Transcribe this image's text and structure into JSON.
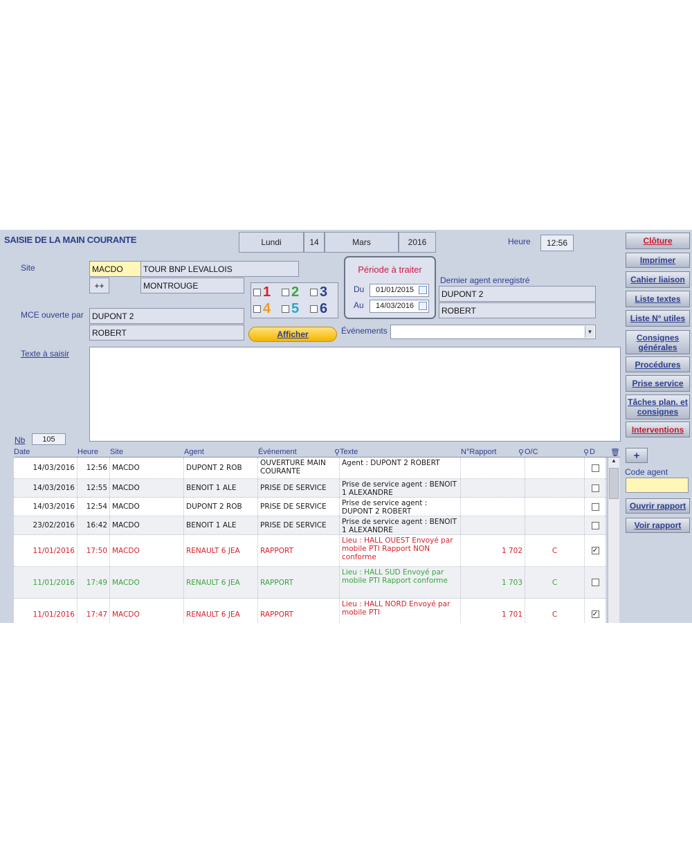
{
  "title": "SAISIE DE LA MAIN COURANTE",
  "date": {
    "day_name": "Lundi",
    "day": "14",
    "month": "Mars",
    "year": "2016"
  },
  "time": {
    "label": "Heure",
    "value": "12:56"
  },
  "site": {
    "label": "Site",
    "code": "MACDO",
    "name": "TOUR BNP LEVALLOIS",
    "extra_button": "++",
    "city": "MONTROUGE"
  },
  "mce": {
    "label": "MCE ouverte par",
    "name1": "DUPONT 2",
    "name2": "ROBERT"
  },
  "checkboxes": [
    {
      "num": "1",
      "color": "#d61f2a"
    },
    {
      "num": "2",
      "color": "#3aa53c"
    },
    {
      "num": "3",
      "color": "#2d3f8c"
    },
    {
      "num": "4",
      "color": "#f29a1e"
    },
    {
      "num": "5",
      "color": "#2aa7c8"
    },
    {
      "num": "6",
      "color": "#2d3f8c"
    }
  ],
  "periode": {
    "title": "Période à traiter",
    "du_label": "Du",
    "du_value": "01/01/2015",
    "au_label": "Au",
    "au_value": "14/03/2016"
  },
  "dernier_agent": {
    "label": "Dernier agent enregistré",
    "name1": "DUPONT 2",
    "name2": "ROBERT"
  },
  "afficher_label": "Afficher",
  "evenements_label": "Événements",
  "texte_label": "Texte à saisir",
  "nb": {
    "label": "Nb",
    "value": "105"
  },
  "side_buttons": [
    {
      "label": "Clôture",
      "red": true
    },
    {
      "label": "Imprimer",
      "red": false
    },
    {
      "label": "Cahier liaison",
      "red": false
    },
    {
      "label": "Liste textes",
      "red": false
    },
    {
      "label": "Liste N° utiles",
      "red": false
    },
    {
      "label": "Consignes générales",
      "red": false
    },
    {
      "label": "Procédures",
      "red": false
    },
    {
      "label": "Prise service",
      "red": false
    },
    {
      "label": "Tâches plan. et consignes",
      "red": false
    },
    {
      "label": "Interventions",
      "red": true
    }
  ],
  "plus_label": "+",
  "code_agent_label": "Code agent",
  "ouvrir_rapport": "Ouvrir rapport",
  "voir_rapport": "Voir rapport",
  "columns": {
    "date": "Date",
    "heure": "Heure",
    "site": "Site",
    "agent": "Agent",
    "evenement": "Événement",
    "texte": "Texte",
    "rapport": "N°Rapport",
    "oc": "O/C",
    "d": "D"
  },
  "rows": [
    {
      "date": "14/03/2016",
      "heure": "12:56",
      "site": "MACDO",
      "agent": "DUPONT 2 ROB",
      "evenement": "OUVERTURE MAIN COURANTE",
      "texte": "Agent : DUPONT 2 ROBERT",
      "rapport": "",
      "oc": "",
      "checked": false,
      "color": "normal"
    },
    {
      "date": "14/03/2016",
      "heure": "12:55",
      "site": "MACDO",
      "agent": "BENOIT 1 ALE",
      "evenement": "PRISE DE SERVICE",
      "texte": "Prise de service agent : BENOIT 1 ALEXANDRE",
      "rapport": "",
      "oc": "",
      "checked": false,
      "color": "normal"
    },
    {
      "date": "14/03/2016",
      "heure": "12:54",
      "site": "MACDO",
      "agent": "DUPONT 2 ROB",
      "evenement": "PRISE DE SERVICE",
      "texte": "Prise de service agent : DUPONT 2 ROBERT",
      "rapport": "",
      "oc": "",
      "checked": false,
      "color": "normal"
    },
    {
      "date": "23/02/2016",
      "heure": "16:42",
      "site": "MACDO",
      "agent": "BENOIT 1 ALE",
      "evenement": "PRISE DE SERVICE",
      "texte": "Prise de service agent : BENOIT 1 ALEXANDRE",
      "rapport": "",
      "oc": "",
      "checked": false,
      "color": "normal"
    },
    {
      "date": "11/01/2016",
      "heure": "17:50",
      "site": "MACDO",
      "agent": "RENAULT 6 JEA",
      "evenement": "RAPPORT",
      "texte": "Lieu : HALL OUEST Envoyé par mobile PTI Rapport NON conforme",
      "rapport": "1 702",
      "oc": "C",
      "checked": true,
      "color": "red"
    },
    {
      "date": "11/01/2016",
      "heure": "17:49",
      "site": "MACDO",
      "agent": "RENAULT 6 JEA",
      "evenement": "RAPPORT",
      "texte": "Lieu : HALL SUD Envoyé par mobile PTI Rapport conforme",
      "rapport": "1 703",
      "oc": "C",
      "checked": false,
      "color": "green"
    },
    {
      "date": "11/01/2016",
      "heure": "17:47",
      "site": "MACDO",
      "agent": "RENAULT 6 JEA",
      "evenement": "RAPPORT",
      "texte": "Lieu : HALL NORD Envoyé par mobile PTI",
      "rapport": "1 701",
      "oc": "C",
      "checked": true,
      "color": "red"
    }
  ]
}
